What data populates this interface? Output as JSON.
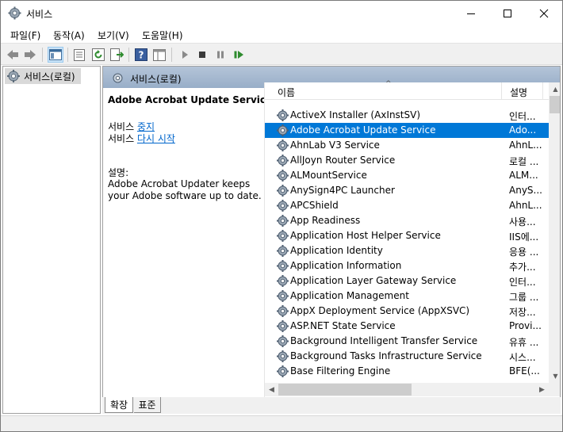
{
  "window": {
    "title": "서비스"
  },
  "menu": {
    "file": "파일(F)",
    "action": "동작(A)",
    "view": "보기(V)",
    "help": "도움말(H)"
  },
  "toolbar": {
    "icons": [
      "back-arrow-icon",
      "forward-arrow-icon",
      "console-tree-icon",
      "properties-icon",
      "refresh-icon",
      "export-list-icon",
      "help-icon",
      "mmc-pane-icon",
      "start-icon",
      "stop-icon",
      "pause-icon",
      "restart-icon"
    ]
  },
  "tree": {
    "root_label": "서비스(로컬)"
  },
  "header": {
    "title": "서비스(로컬)"
  },
  "detail": {
    "service_name": "Adobe Acrobat Update Service",
    "line1_prefix": "서비스 ",
    "stop_link": "중지",
    "line2_prefix": "서비스 ",
    "restart_link": "다시 시작",
    "desc_label": "설명:",
    "desc_text": "Adobe Acrobat Updater keeps your Adobe software up to date."
  },
  "list": {
    "columns": {
      "name": "이름",
      "description": "설명"
    },
    "selected_index": 1,
    "rows": [
      {
        "name": "ActiveX Installer (AxInstSV)",
        "desc": "인터..."
      },
      {
        "name": "Adobe Acrobat Update Service",
        "desc": "Ado..."
      },
      {
        "name": "AhnLab V3 Service",
        "desc": "AhnL..."
      },
      {
        "name": "AllJoyn Router Service",
        "desc": "로컬 ..."
      },
      {
        "name": "ALMountService",
        "desc": "ALM..."
      },
      {
        "name": "AnySign4PC Launcher",
        "desc": "AnyS..."
      },
      {
        "name": "APCShield",
        "desc": "AhnL..."
      },
      {
        "name": "App Readiness",
        "desc": "사용..."
      },
      {
        "name": "Application Host Helper Service",
        "desc": "IIS에..."
      },
      {
        "name": "Application Identity",
        "desc": "응용 ..."
      },
      {
        "name": "Application Information",
        "desc": "추가..."
      },
      {
        "name": "Application Layer Gateway Service",
        "desc": "인터..."
      },
      {
        "name": "Application Management",
        "desc": "그룹 ..."
      },
      {
        "name": "AppX Deployment Service (AppXSVC)",
        "desc": "저장..."
      },
      {
        "name": "ASP.NET State Service",
        "desc": "Provi..."
      },
      {
        "name": "Background Intelligent Transfer Service",
        "desc": "유휴 ..."
      },
      {
        "name": "Background Tasks Infrastructure Service",
        "desc": "시스..."
      },
      {
        "name": "Base Filtering Engine",
        "desc": "BFE(..."
      }
    ]
  },
  "tabs": {
    "extended": "확장",
    "standard": "표준"
  },
  "colors": {
    "selection": "#0078d7",
    "header_band": "#a6b8cf",
    "link": "#0066cc"
  }
}
